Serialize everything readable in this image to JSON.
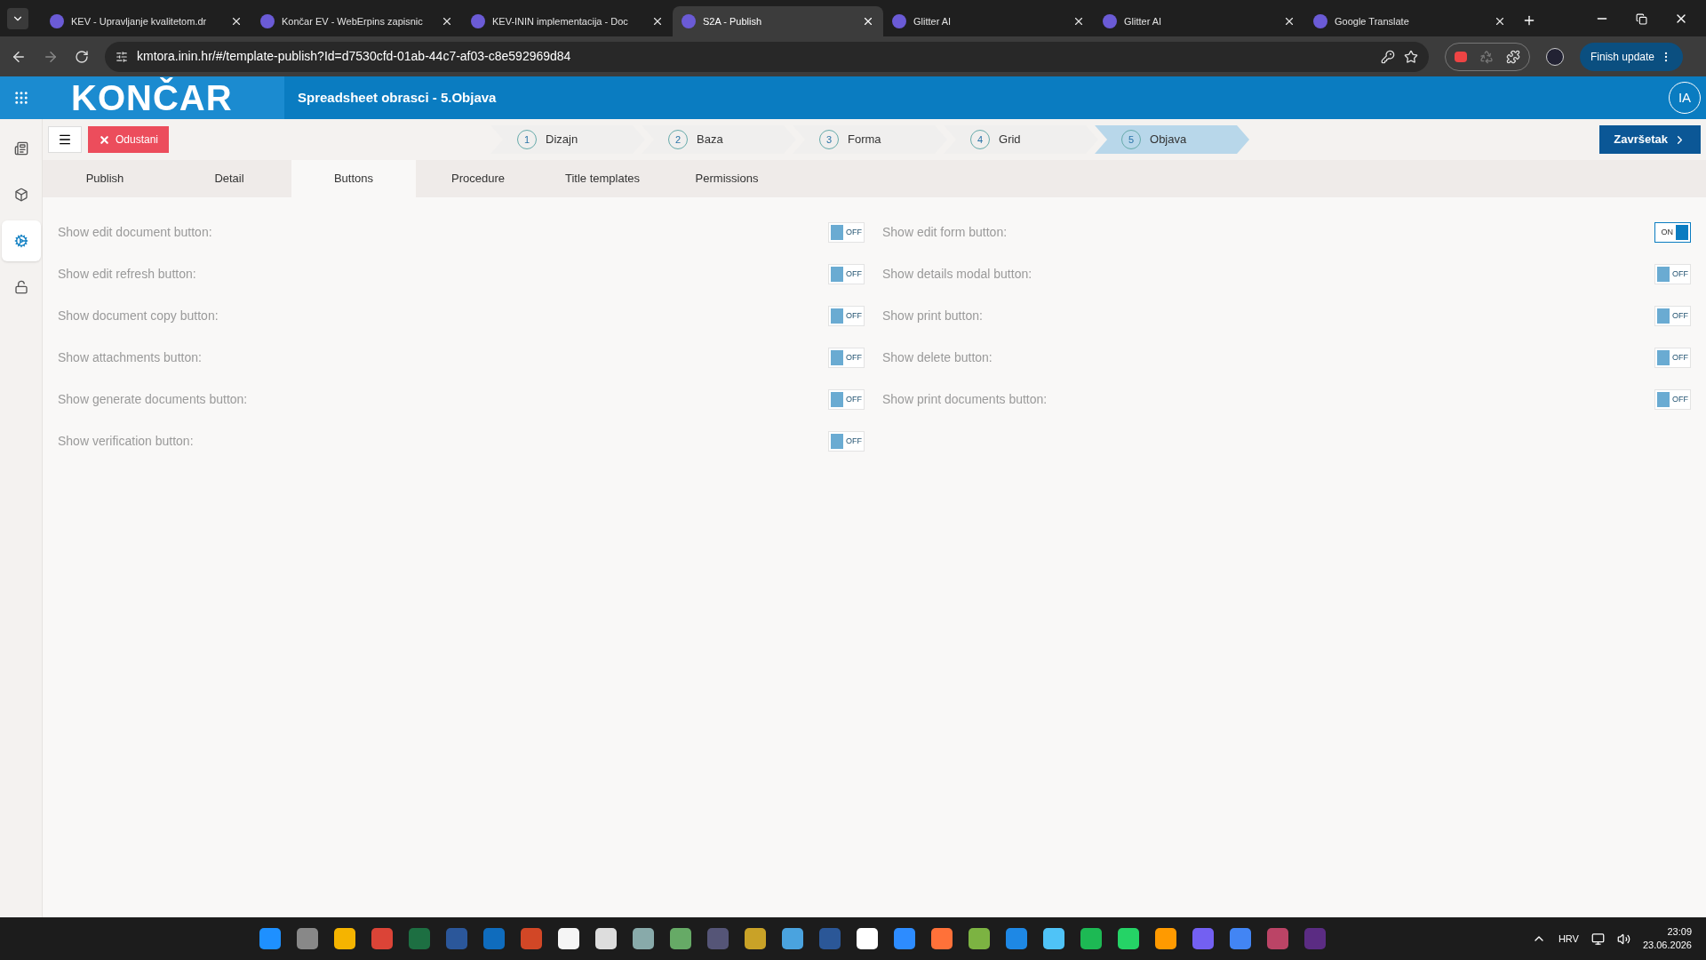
{
  "browser": {
    "tabs": [
      {
        "title": "KEV - Upravljanje kvalitetom.dr",
        "selected": false
      },
      {
        "title": "Končar EV - WebErpins zapisnic",
        "selected": false
      },
      {
        "title": "KEV-ININ implementacija - Doc",
        "selected": false
      },
      {
        "title": "S2A - Publish",
        "selected": true
      },
      {
        "title": "Glitter AI",
        "selected": false
      },
      {
        "title": "Glitter AI",
        "selected": false
      },
      {
        "title": "Google Translate",
        "selected": false
      }
    ],
    "address": "kmtora.inin.hr/#/template-publish?Id=d7530cfd-01ab-44c7-af03-c8e592969d84",
    "update_button": "Finish update"
  },
  "header": {
    "logo": "KONČAR",
    "title": "Spreadsheet obrasci - 5.Objava",
    "avatar": "IA"
  },
  "sidebar": {
    "items": [
      {
        "selected": false
      },
      {
        "selected": false
      },
      {
        "selected": true
      },
      {
        "selected": false
      }
    ]
  },
  "toolbar": {
    "cancel_button": "Odustani",
    "finish_button": "Završetak",
    "steps": [
      {
        "number": "1",
        "label": "Dizajn",
        "selected": false
      },
      {
        "number": "2",
        "label": "Baza",
        "selected": false
      },
      {
        "number": "3",
        "label": "Forma",
        "selected": false
      },
      {
        "number": "4",
        "label": "Grid",
        "selected": false
      },
      {
        "number": "5",
        "label": "Objava",
        "selected": true
      }
    ]
  },
  "tabs": [
    {
      "label": "Publish",
      "selected": false
    },
    {
      "label": "Detail",
      "selected": false
    },
    {
      "label": "Buttons",
      "selected": true
    },
    {
      "label": "Procedure",
      "selected": false
    },
    {
      "label": "Title templates",
      "selected": false
    },
    {
      "label": "Permissions",
      "selected": false
    }
  ],
  "settings": {
    "left": [
      {
        "label": "Show edit document button:",
        "on": false,
        "state_label": "OFF"
      },
      {
        "label": "Show edit refresh button:",
        "on": false,
        "state_label": "OFF"
      },
      {
        "label": "Show document copy button:",
        "on": false,
        "state_label": "OFF"
      },
      {
        "label": "Show attachments button:",
        "on": false,
        "state_label": "OFF"
      },
      {
        "label": "Show generate documents button:",
        "on": false,
        "state_label": "OFF"
      },
      {
        "label": "Show verification button:",
        "on": false,
        "state_label": "OFF"
      }
    ],
    "right": [
      {
        "label": "Show edit form button:",
        "on": true,
        "state_label": "ON"
      },
      {
        "label": "Show details modal button:",
        "on": false,
        "state_label": "OFF"
      },
      {
        "label": "Show print button:",
        "on": false,
        "state_label": "OFF"
      },
      {
        "label": "Show delete button:",
        "on": false,
        "state_label": "OFF"
      },
      {
        "label": "Show print documents button:",
        "on": false,
        "state_label": "OFF"
      }
    ]
  },
  "taskbar": {
    "language": "HRV",
    "time": "23:09",
    "date": "23.06.2026"
  }
}
